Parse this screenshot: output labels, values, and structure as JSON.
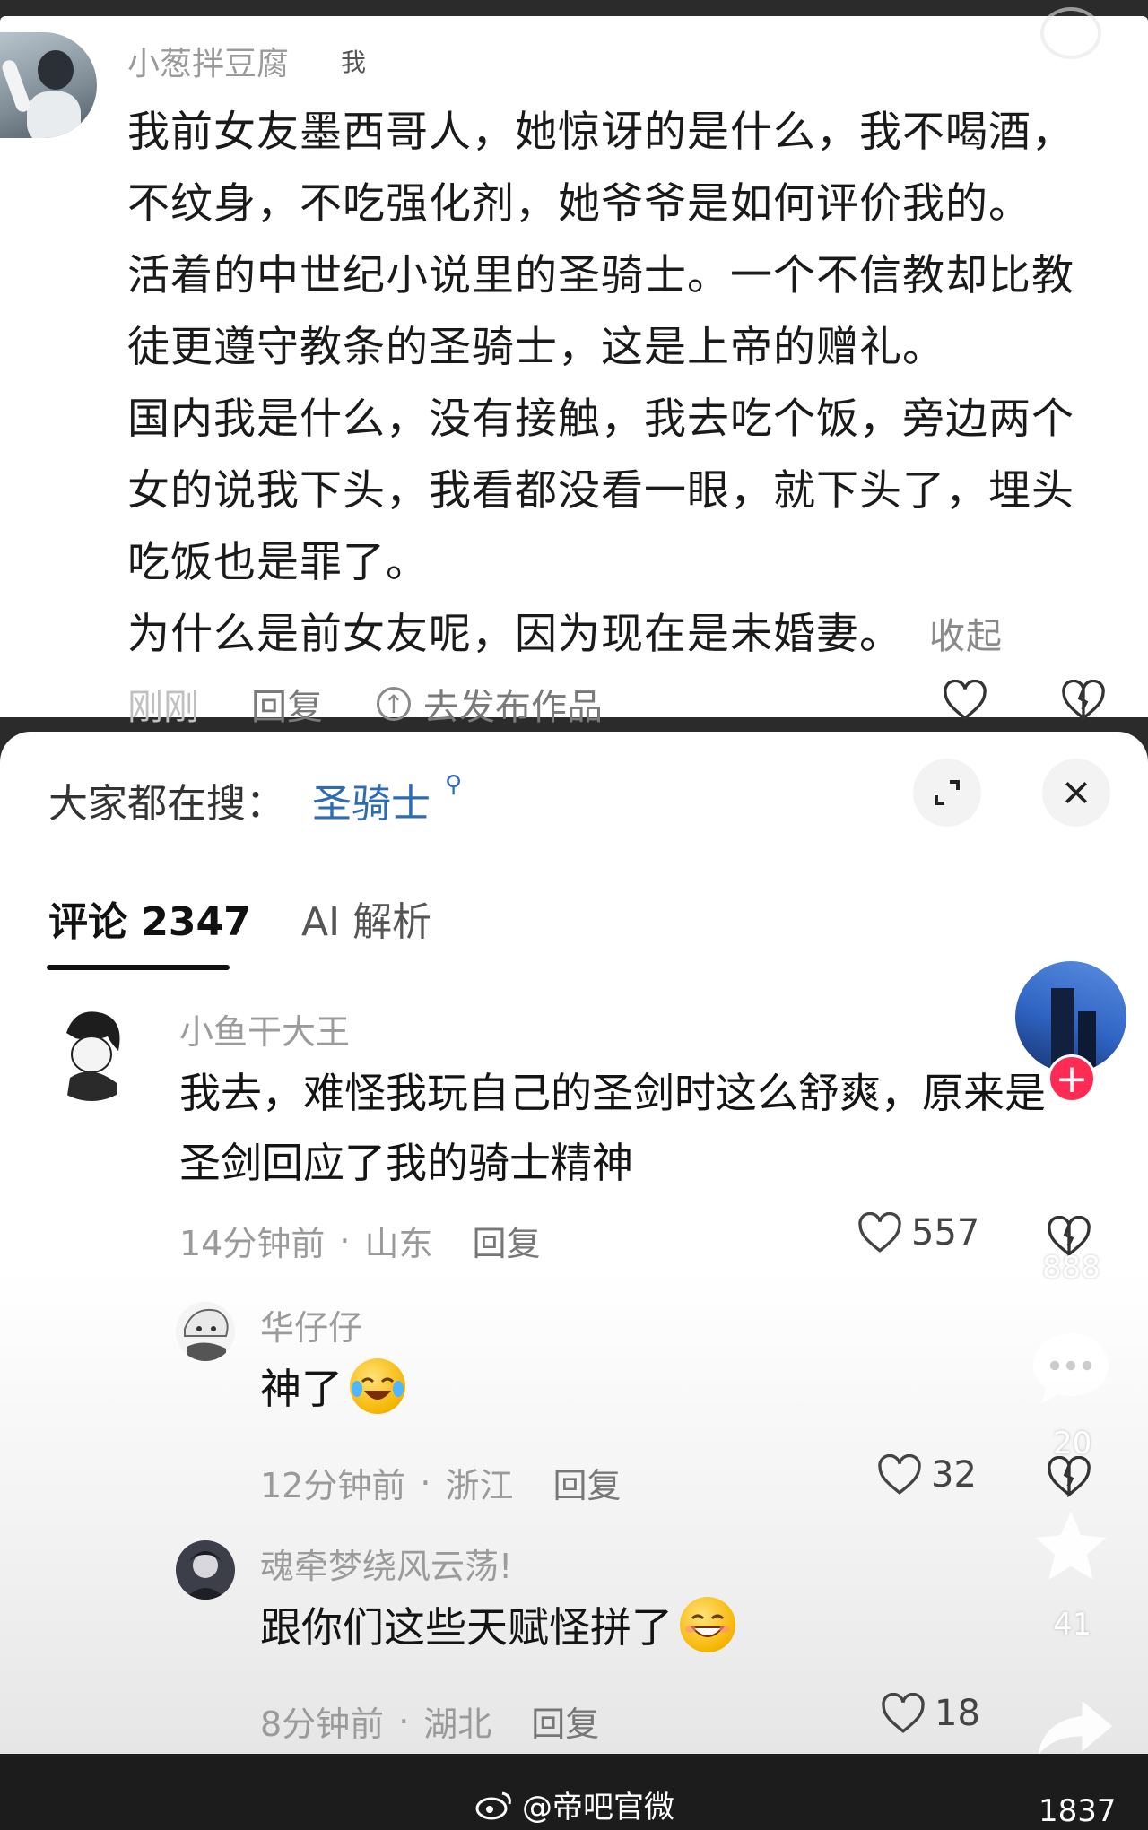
{
  "top_comment": {
    "username": "小葱拌豆腐",
    "me_tag": "我",
    "paragraphs": [
      "我前女友墨西哥人，她惊讶的是什么，我不喝酒，不纹身，不吃强化剂，她爷爷是如何评价我的。",
      "活着的中世纪小说里的圣骑士。一个不信教却比教徒更遵守教条的圣骑士，这是上帝的赠礼。",
      "国内我是什么，没有接触，我去吃个饭，旁边两个女的说我下头，我看都没看一眼，就下头了，埋头吃饭也是罪了。",
      "为什么是前女友呢，因为现在是未婚妻。"
    ],
    "collapse_label": "收起",
    "time": "刚刚",
    "reply_label": "回复",
    "publish_label": "去发布作品"
  },
  "search": {
    "label": "大家都在搜：",
    "keyword": "圣骑士"
  },
  "tabs": {
    "comments": "评论 2347",
    "ai": "AI 解析"
  },
  "comments": [
    {
      "username": "小鱼干大王",
      "lines": [
        "我去，难怪我玩自己的圣剑时这么舒爽，原来是",
        "圣剑回应了我的骑士精神"
      ],
      "time": "14分钟前",
      "location": "山东",
      "reply_label": "回复",
      "likes": "557"
    },
    {
      "username": "华仔仔",
      "text": "神了",
      "time": "12分钟前",
      "location": "浙江",
      "reply_label": "回复",
      "likes": "32"
    },
    {
      "username": "魂牵梦绕风云荡!",
      "text": "跟你们这些天赋怪拼了",
      "time": "8分钟前",
      "location": "湖北",
      "reply_label": "回复",
      "likes": "18"
    }
  ],
  "side_bar": {
    "like_count": "888",
    "comment_count": "20",
    "favorite_count": "41",
    "share_count": "1837"
  },
  "watermark": "@帝吧官微",
  "colors": {
    "accent_blue": "#2d6bb5",
    "follow_red": "#fe2c55"
  }
}
